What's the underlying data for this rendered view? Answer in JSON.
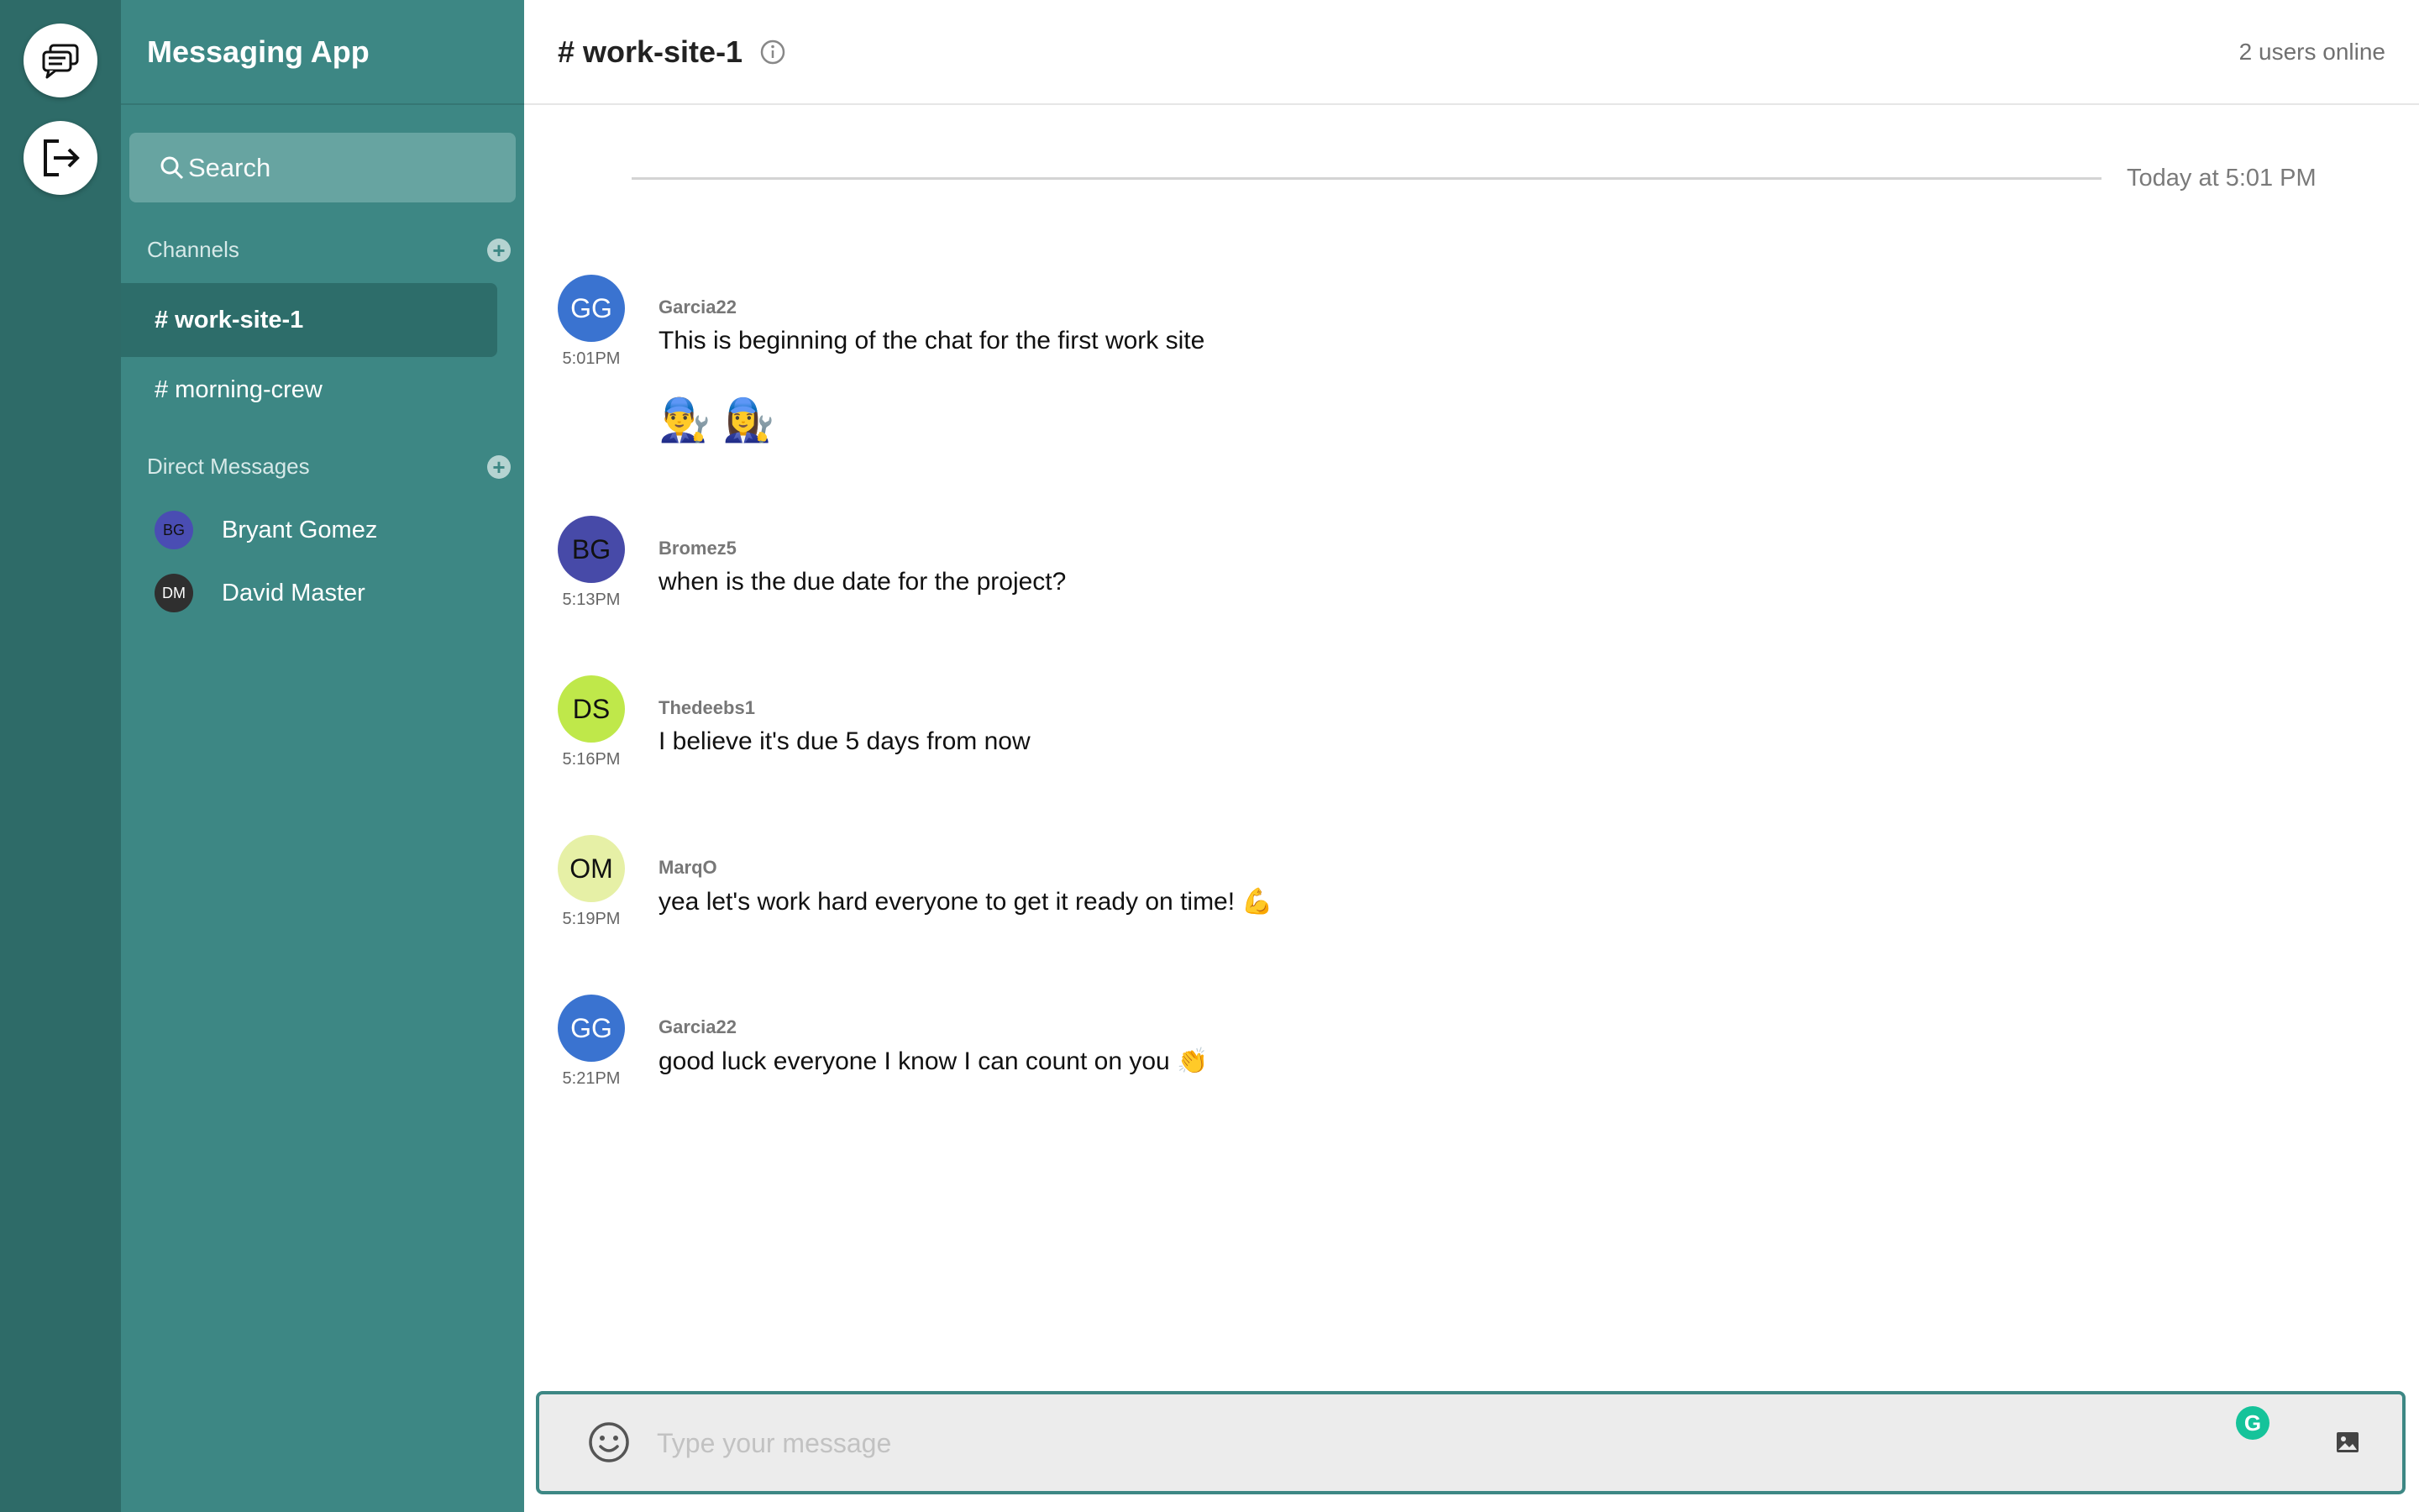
{
  "app": {
    "title": "Messaging App"
  },
  "rail": {
    "chat_icon": "chat-bubbles-icon",
    "logout_icon": "logout-icon"
  },
  "search": {
    "placeholder": "Search"
  },
  "sidebar": {
    "channels_label": "Channels",
    "channels": [
      {
        "label": "# work-site-1",
        "active": true
      },
      {
        "label": "# morning-crew",
        "active": false
      }
    ],
    "dms_label": "Direct Messages",
    "dms": [
      {
        "initials": "BG",
        "name": "Bryant Gomez",
        "color": "#4a4db3"
      },
      {
        "initials": "DM",
        "name": "David Master",
        "color": "#2f2f2f"
      }
    ]
  },
  "header": {
    "channel": "# work-site-1",
    "online": "2 users online"
  },
  "divider": {
    "label": "Today at 5:01 PM"
  },
  "messages": [
    {
      "initials": "GG",
      "avatar_color": "#3a73d0",
      "initials_color": "#ffffff",
      "time": "5:01PM",
      "user": "Garcia22",
      "text": "This is beginning of the chat for the first work site",
      "emojis": "👨‍🔧 👩‍🔧"
    },
    {
      "initials": "BG",
      "avatar_color": "#474aa8",
      "initials_color": "#111111",
      "time": "5:13PM",
      "user": "Bromez5",
      "text": "when is the due date for the project?"
    },
    {
      "initials": "DS",
      "avatar_color": "#bfe84a",
      "initials_color": "#111111",
      "time": "5:16PM",
      "user": "Thedeebs1",
      "text": "I believe it's due 5 days from now"
    },
    {
      "initials": "OM",
      "avatar_color": "#e6f0a6",
      "initials_color": "#111111",
      "time": "5:19PM",
      "user": "MarqO",
      "text": "yea let's work hard everyone to get it ready on time! 💪"
    },
    {
      "initials": "GG",
      "avatar_color": "#3a73d0",
      "initials_color": "#ffffff",
      "time": "5:21PM",
      "user": "Garcia22",
      "text": "good luck everyone I know I can count on you 👏"
    }
  ],
  "composer": {
    "placeholder": "Type your message",
    "grammarly_badge": "G"
  },
  "colors": {
    "rail": "#2e6b68",
    "sidebar": "#3d8784",
    "active_channel": "#2d6d6a",
    "accent": "#3d8784"
  }
}
